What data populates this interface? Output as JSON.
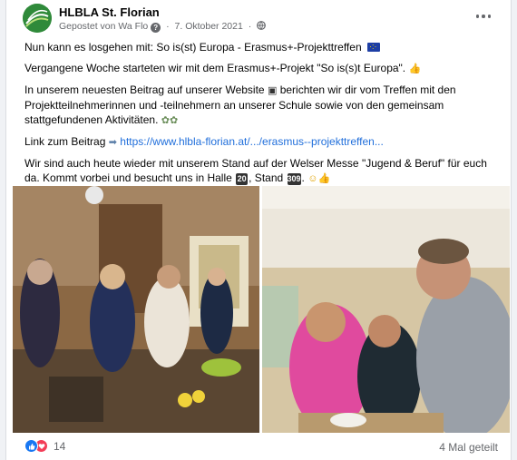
{
  "post": {
    "page_name": "HLBLA St. Florian",
    "posted_by": "Gepostet von Wa Flo",
    "date": "7. Oktober 2021",
    "paragraphs": {
      "p1": "Nun kann es losgehen mit: So is(st) Europa - Erasmus+-Projekttreffen",
      "p2": "Vergangene Woche starteten wir mit dem Erasmus+-Projekt \"So is(s)t Europa\".",
      "p3": "In unserem neuesten Beitrag auf unserer Website",
      "p3b": "berichten wir dir vom Treffen mit den Projektteilnehmerinnen und -teilnehmern an unserer Schule sowie von den gemeinsam stattgefundenen Aktivitäten.",
      "p4_label": "Link zum Beitrag",
      "p4_link": "https://www.hlbla-florian.at/.../erasmus--projekttreffen...",
      "p5": "Wir sind auch heute wieder mit unserem Stand auf der Welser Messe \"Jugend & Beruf\" für euch da. Kommt vorbei und besucht uns in Halle",
      "p5_halle": "20",
      "p5_stand_label": ", Stand",
      "p5_stand": "309",
      "p5_end": "."
    }
  },
  "footer": {
    "reaction_count": "14",
    "shares": "4 Mal geteilt"
  },
  "icons": {
    "avatar": "page-logo-icon",
    "more": "more-options-icon",
    "globe": "globe-icon",
    "like": "like-icon",
    "love": "love-icon"
  },
  "colors": {
    "link": "#216fdb",
    "like": "#1877f2",
    "love": "#f33e58",
    "avatar": "#2f8a3a"
  }
}
